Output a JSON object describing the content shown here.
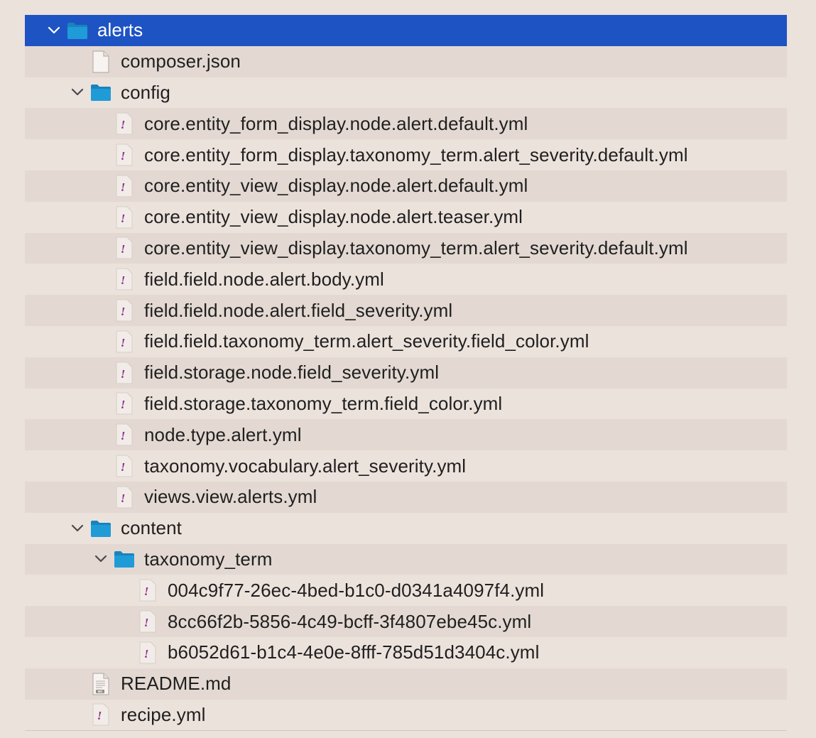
{
  "colors": {
    "background": "#ece2dc",
    "stripe": "#e3d9d2",
    "selection": "#1e53c4",
    "folder": "#1f9bd7",
    "yaml_mark": "#8a2f8f"
  },
  "tree": [
    {
      "label": "alerts",
      "kind": "folder",
      "depth": 0,
      "expanded": true,
      "selected": true,
      "icon": "folder-icon"
    },
    {
      "label": "composer.json",
      "kind": "file",
      "depth": 1,
      "icon": "json-file-icon"
    },
    {
      "label": "config",
      "kind": "folder",
      "depth": 1,
      "expanded": true,
      "icon": "folder-icon"
    },
    {
      "label": "core.entity_form_display.node.alert.default.yml",
      "kind": "file",
      "depth": 2,
      "icon": "yaml-file-icon"
    },
    {
      "label": "core.entity_form_display.taxonomy_term.alert_severity.default.yml",
      "kind": "file",
      "depth": 2,
      "icon": "yaml-file-icon"
    },
    {
      "label": "core.entity_view_display.node.alert.default.yml",
      "kind": "file",
      "depth": 2,
      "icon": "yaml-file-icon"
    },
    {
      "label": "core.entity_view_display.node.alert.teaser.yml",
      "kind": "file",
      "depth": 2,
      "icon": "yaml-file-icon"
    },
    {
      "label": "core.entity_view_display.taxonomy_term.alert_severity.default.yml",
      "kind": "file",
      "depth": 2,
      "icon": "yaml-file-icon"
    },
    {
      "label": "field.field.node.alert.body.yml",
      "kind": "file",
      "depth": 2,
      "icon": "yaml-file-icon"
    },
    {
      "label": "field.field.node.alert.field_severity.yml",
      "kind": "file",
      "depth": 2,
      "icon": "yaml-file-icon"
    },
    {
      "label": "field.field.taxonomy_term.alert_severity.field_color.yml",
      "kind": "file",
      "depth": 2,
      "icon": "yaml-file-icon"
    },
    {
      "label": "field.storage.node.field_severity.yml",
      "kind": "file",
      "depth": 2,
      "icon": "yaml-file-icon"
    },
    {
      "label": "field.storage.taxonomy_term.field_color.yml",
      "kind": "file",
      "depth": 2,
      "icon": "yaml-file-icon"
    },
    {
      "label": "node.type.alert.yml",
      "kind": "file",
      "depth": 2,
      "icon": "yaml-file-icon"
    },
    {
      "label": "taxonomy.vocabulary.alert_severity.yml",
      "kind": "file",
      "depth": 2,
      "icon": "yaml-file-icon"
    },
    {
      "label": "views.view.alerts.yml",
      "kind": "file",
      "depth": 2,
      "icon": "yaml-file-icon"
    },
    {
      "label": "content",
      "kind": "folder",
      "depth": 1,
      "expanded": true,
      "icon": "folder-icon"
    },
    {
      "label": "taxonomy_term",
      "kind": "folder",
      "depth": 2,
      "expanded": true,
      "icon": "folder-icon"
    },
    {
      "label": "004c9f77-26ec-4bed-b1c0-d0341a4097f4.yml",
      "kind": "file",
      "depth": 3,
      "icon": "yaml-file-icon"
    },
    {
      "label": "8cc66f2b-5856-4c49-bcff-3f4807ebe45c.yml",
      "kind": "file",
      "depth": 3,
      "icon": "yaml-file-icon"
    },
    {
      "label": "b6052d61-b1c4-4e0e-8fff-785d51d3404c.yml",
      "kind": "file",
      "depth": 3,
      "icon": "yaml-file-icon"
    },
    {
      "label": "README.md",
      "kind": "file",
      "depth": 1,
      "icon": "markdown-file-icon",
      "badge": "MD"
    },
    {
      "label": "recipe.yml",
      "kind": "file",
      "depth": 1,
      "icon": "yaml-file-icon"
    }
  ]
}
